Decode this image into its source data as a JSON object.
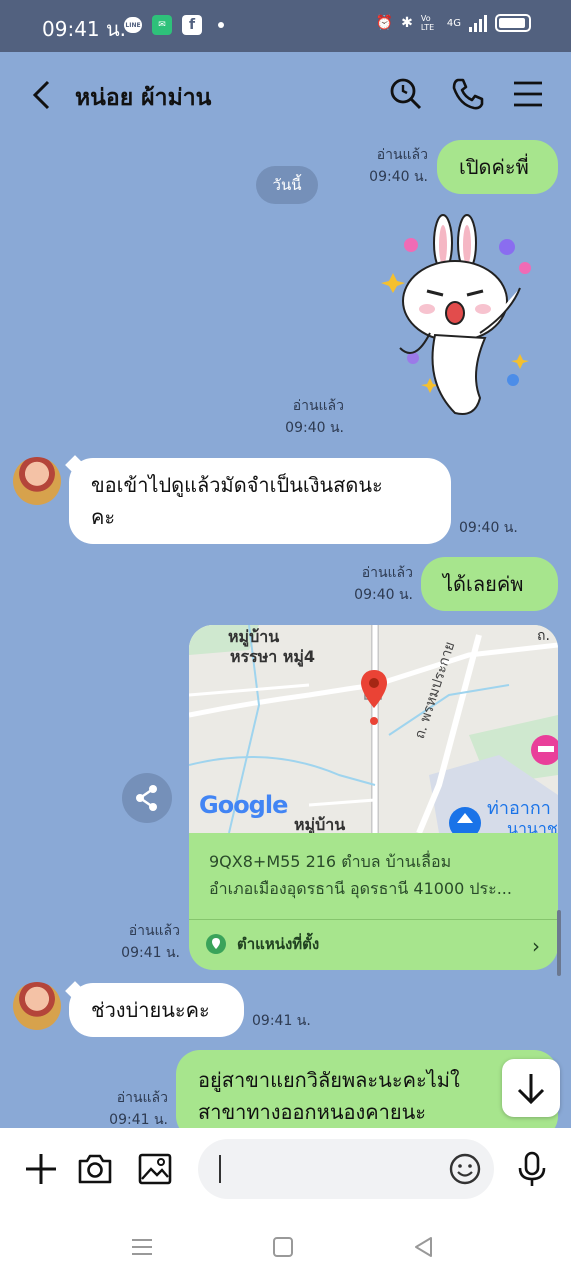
{
  "status_bar": {
    "time": "09:41 น.",
    "network": "4G",
    "volte": "Vo LTE",
    "line_label": "LINE"
  },
  "header": {
    "title": "หน่อย ผ้าม่าน"
  },
  "chat": {
    "date_chip": "วันนี้",
    "messages": [
      {
        "text": "เปิดค่ะพี่",
        "read": "อ่านแล้ว",
        "time": "09:40 น."
      },
      {
        "read": "อ่านแล้ว",
        "time": "09:40 น."
      },
      {
        "text": "ขอเข้าไปดูแล้วมัดจำเป็นเงินสดนะ",
        "text2": "คะ",
        "time": "09:40 น."
      },
      {
        "text": "ได้เลยค่พ",
        "read": "อ่านแล้ว",
        "time": "09:40 น."
      },
      {
        "read": "อ่านแล้ว",
        "time": "09:41 น."
      },
      {
        "text": "ช่วงบ่ายนะคะ",
        "time": "09:41 น."
      },
      {
        "text": "อยู่สาขาแยกวิลัยพละนะคะไม่ใ",
        "text2": "สาขาทางออกหนองคายนะ",
        "read": "อ่านแล้ว",
        "time": "09:41 น."
      }
    ],
    "location": {
      "address_line1": "9QX8+M55 216 ตำบล บ้านเลื่อม",
      "address_line2": "อำเภอเมืองอุดรธานี อุดรธานี 41000 ประ...",
      "footer_label": "ตำแหน่งที่ตั้ง",
      "map_labels": {
        "village1": "หมู่บ้าน",
        "village1b": "หรรษา หมู่4",
        "road": "ถ. พรหมประกาย",
        "village2": "หมู่บ้าน",
        "airport1": "ท่าอากา",
        "airport2": "นานาช",
        "corner": "ถ.",
        "google": "Google"
      }
    }
  },
  "input": {
    "placeholder": ""
  },
  "colors": {
    "chat_bg": "#8aa9d6",
    "out_bubble": "#a7e58d",
    "in_bubble": "#ffffff",
    "status_bar": "#52617f",
    "pin": "#ea4335"
  }
}
